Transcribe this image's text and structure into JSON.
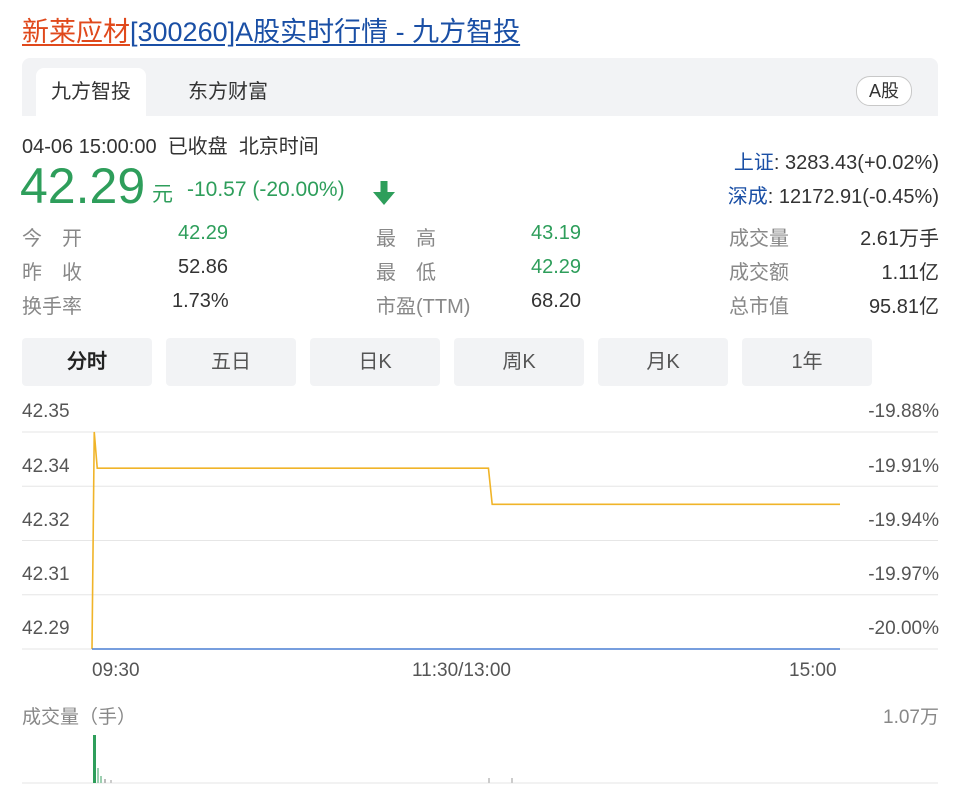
{
  "page": {
    "title_stock": "新莱应材",
    "title_rest": "[300260]A股实时行情 - 九方智投"
  },
  "tabs": [
    {
      "label": "九方智投",
      "active": true
    },
    {
      "label": "东方财富",
      "active": false
    }
  ],
  "market_badge": "A股",
  "quote": {
    "datetime": "04-06 15:00:00",
    "status": "已收盘",
    "timezone": "北京时间",
    "price": "42.29",
    "currency": "元",
    "change": "-10.57 (-20.00%)",
    "direction": "down",
    "color_down": "#2e9e5b"
  },
  "indices": [
    {
      "name": "上证",
      "value": ": 3283.43(+0.02%)"
    },
    {
      "name": "深成",
      "value": ": 12172.91(-0.45%)"
    }
  ],
  "stats": [
    {
      "label": "今　开",
      "value": "42.29",
      "green": true
    },
    {
      "label": "最　高",
      "value": "43.19",
      "green": true
    },
    {
      "label": "成交量",
      "value": "2.61万手",
      "green": false
    },
    {
      "label": "昨　收",
      "value": "52.86",
      "green": false
    },
    {
      "label": "最　低",
      "value": "42.29",
      "green": true
    },
    {
      "label": "成交额",
      "value": "1.11亿",
      "green": false
    },
    {
      "label": "换手率",
      "value": "1.73%",
      "green": false
    },
    {
      "label": "市盈(TTM)",
      "value": "68.20",
      "green": false
    },
    {
      "label": "总市值",
      "value": "95.81亿",
      "green": false
    }
  ],
  "periods": [
    {
      "label": "分时",
      "active": true
    },
    {
      "label": "五日",
      "active": false
    },
    {
      "label": "日K",
      "active": false
    },
    {
      "label": "周K",
      "active": false
    },
    {
      "label": "月K",
      "active": false
    },
    {
      "label": "1年",
      "active": false
    }
  ],
  "chart_data": {
    "type": "line",
    "y_ticks_left": [
      "42.35",
      "42.34",
      "42.32",
      "42.31",
      "42.29"
    ],
    "y_ticks_right": [
      "-19.88%",
      "-19.91%",
      "-19.94%",
      "-19.97%",
      "-20.00%"
    ],
    "x_ticks": [
      "09:30",
      "11:30/13:00",
      "15:00"
    ],
    "ylim": [
      42.29,
      42.35
    ],
    "price_series": {
      "color": "#f0b429",
      "points": [
        [
          0.0,
          42.29
        ],
        [
          0.003,
          42.35
        ],
        [
          0.007,
          42.34
        ],
        [
          0.53,
          42.34
        ],
        [
          0.535,
          42.33
        ],
        [
          1.0,
          42.33
        ]
      ]
    },
    "avg_series": {
      "color": "#4a7fd4",
      "points": [
        [
          0.0,
          42.29
        ],
        [
          1.0,
          42.29
        ]
      ]
    },
    "grid": true
  },
  "volume": {
    "label": "成交量（手）",
    "max_label": "1.07万",
    "bar_color": "#2e9e5b"
  }
}
